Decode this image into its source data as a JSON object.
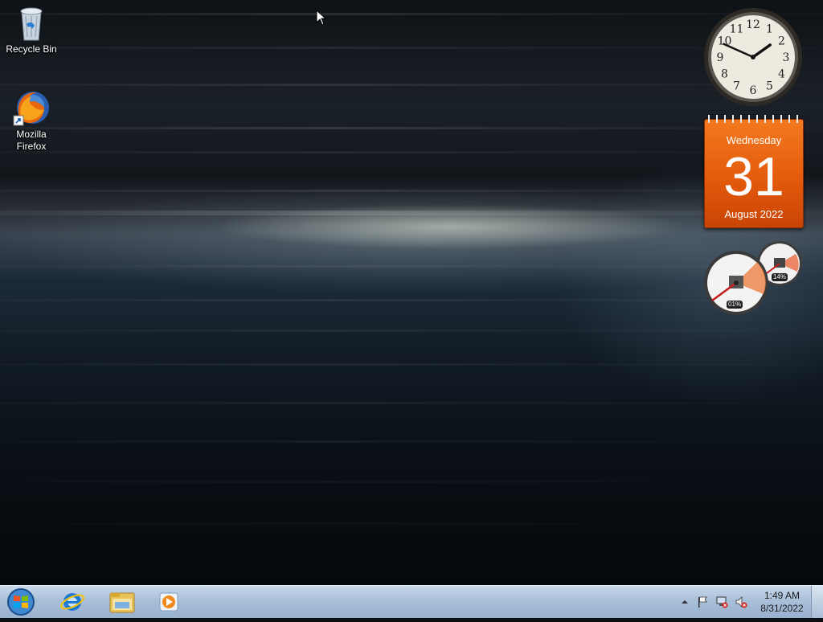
{
  "desktop": {
    "icons": [
      {
        "label": "Recycle Bin",
        "icon": "recycle-bin-icon"
      },
      {
        "label": "Mozilla Firefox",
        "icon": "firefox-icon"
      }
    ]
  },
  "gadgets": {
    "clock": {
      "numerals": [
        "12",
        "1",
        "2",
        "3",
        "4",
        "5",
        "6",
        "7",
        "8",
        "9",
        "10",
        "11"
      ],
      "hour": 1,
      "minute": 49
    },
    "calendar": {
      "day_name": "Wednesday",
      "day": "31",
      "month_year": "August 2022",
      "color": "#e65c0d"
    },
    "cpu_meter": {
      "cpu_label": "01%",
      "memory_label": "14%"
    }
  },
  "taskbar": {
    "pinned": [
      {
        "icon": "internet-explorer-icon"
      },
      {
        "icon": "windows-explorer-icon"
      },
      {
        "icon": "media-player-icon"
      }
    ],
    "tray_icons": [
      "show-hidden-icons-icon",
      "action-center-flag-icon",
      "network-icon",
      "volume-muted-icon"
    ],
    "time": "1:49 AM",
    "date": "8/31/2022"
  }
}
